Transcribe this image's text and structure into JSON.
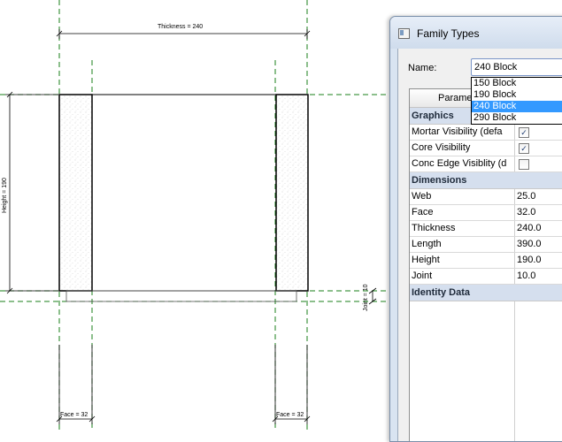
{
  "drawing": {
    "thickness_label": "Thickness = 240",
    "height_label": "Height = 190",
    "joint_label": "Joint = 10",
    "face_left_label": "Face = 32",
    "face_right_label": "Face = 32",
    "colors": {
      "reference_plane": "#1a7f1a",
      "wall": "#000000",
      "dim": "#000000"
    }
  },
  "dialog": {
    "title": "Family Types",
    "name_label": "Name:",
    "selected": "240 Block",
    "options": [
      "150 Block",
      "190 Block",
      "240 Block",
      "290 Block"
    ],
    "highlighted_option": "240 Block",
    "column_header": "Parame",
    "groups": [
      {
        "name": "Graphics",
        "params": [
          {
            "name": "Mortar Visibility (defa",
            "type": "check",
            "checked": true
          },
          {
            "name": "Core Visibility",
            "type": "check",
            "checked": true
          },
          {
            "name": "Conc Edge Visiblity (d",
            "type": "check",
            "checked": false
          }
        ]
      },
      {
        "name": "Dimensions",
        "params": [
          {
            "name": "Web",
            "type": "value",
            "value": "25.0"
          },
          {
            "name": "Face",
            "type": "value",
            "value": "32.0"
          },
          {
            "name": "Thickness",
            "type": "value",
            "value": "240.0"
          },
          {
            "name": "Length",
            "type": "value",
            "value": "390.0"
          },
          {
            "name": "Height",
            "type": "value",
            "value": "190.0"
          },
          {
            "name": "Joint",
            "type": "value",
            "value": "10.0"
          }
        ]
      },
      {
        "name": "Identity Data",
        "params": []
      }
    ],
    "colors": {
      "group_bg": "#d5dfee",
      "selection": "#3399ff"
    }
  }
}
